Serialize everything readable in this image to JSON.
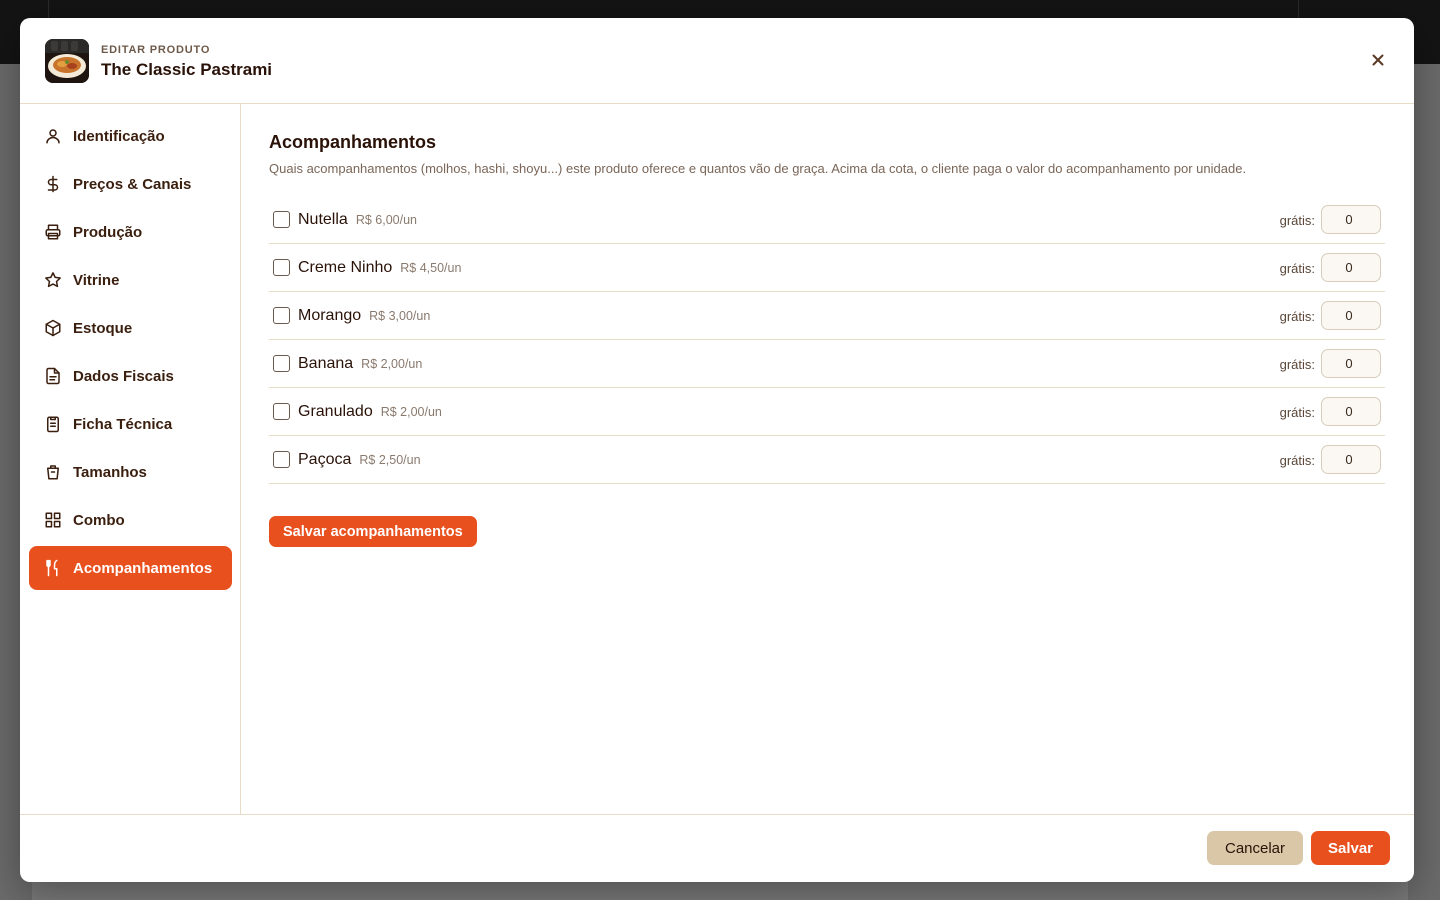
{
  "header": {
    "eyebrow": "EDITAR PRODUTO",
    "title": "The Classic Pastrami",
    "close_icon": "close-icon"
  },
  "sidebar": {
    "items": [
      {
        "label": "Identificação",
        "icon": "user-icon",
        "active": false
      },
      {
        "label": "Preços & Canais",
        "icon": "dollar-icon",
        "active": false
      },
      {
        "label": "Produção",
        "icon": "printer-icon",
        "active": false
      },
      {
        "label": "Vitrine",
        "icon": "star-icon",
        "active": false
      },
      {
        "label": "Estoque",
        "icon": "box-icon",
        "active": false
      },
      {
        "label": "Dados Fiscais",
        "icon": "document-icon",
        "active": false
      },
      {
        "label": "Ficha Técnica",
        "icon": "clipboard-icon",
        "active": false
      },
      {
        "label": "Tamanhos",
        "icon": "cup-icon",
        "active": false
      },
      {
        "label": "Combo",
        "icon": "grid-icon",
        "active": false
      },
      {
        "label": "Acompanhamentos",
        "icon": "utensils-icon",
        "active": true
      }
    ]
  },
  "main": {
    "title": "Acompanhamentos",
    "description": "Quais acompanhamentos (molhos, hashi, shoyu...) este produto oferece e quantos vão de graça. Acima da cota, o cliente paga o valor do acompanhamento por unidade.",
    "free_label": "grátis:",
    "items": [
      {
        "name": "Nutella",
        "price": "R$ 6,00/un",
        "free": "0",
        "checked": false
      },
      {
        "name": "Creme Ninho",
        "price": "R$ 4,50/un",
        "free": "0",
        "checked": false
      },
      {
        "name": "Morango",
        "price": "R$ 3,00/un",
        "free": "0",
        "checked": false
      },
      {
        "name": "Banana",
        "price": "R$ 2,00/un",
        "free": "0",
        "checked": false
      },
      {
        "name": "Granulado",
        "price": "R$ 2,00/un",
        "free": "0",
        "checked": false
      },
      {
        "name": "Paçoca",
        "price": "R$ 2,50/un",
        "free": "0",
        "checked": false
      }
    ],
    "save_extras_label": "Salvar acompanhamentos"
  },
  "footer": {
    "cancel_label": "Cancelar",
    "save_label": "Salvar"
  },
  "colors": {
    "accent": "#e8501e",
    "cancel_bg": "#d9c7a7",
    "text_dark": "#2a1208"
  }
}
